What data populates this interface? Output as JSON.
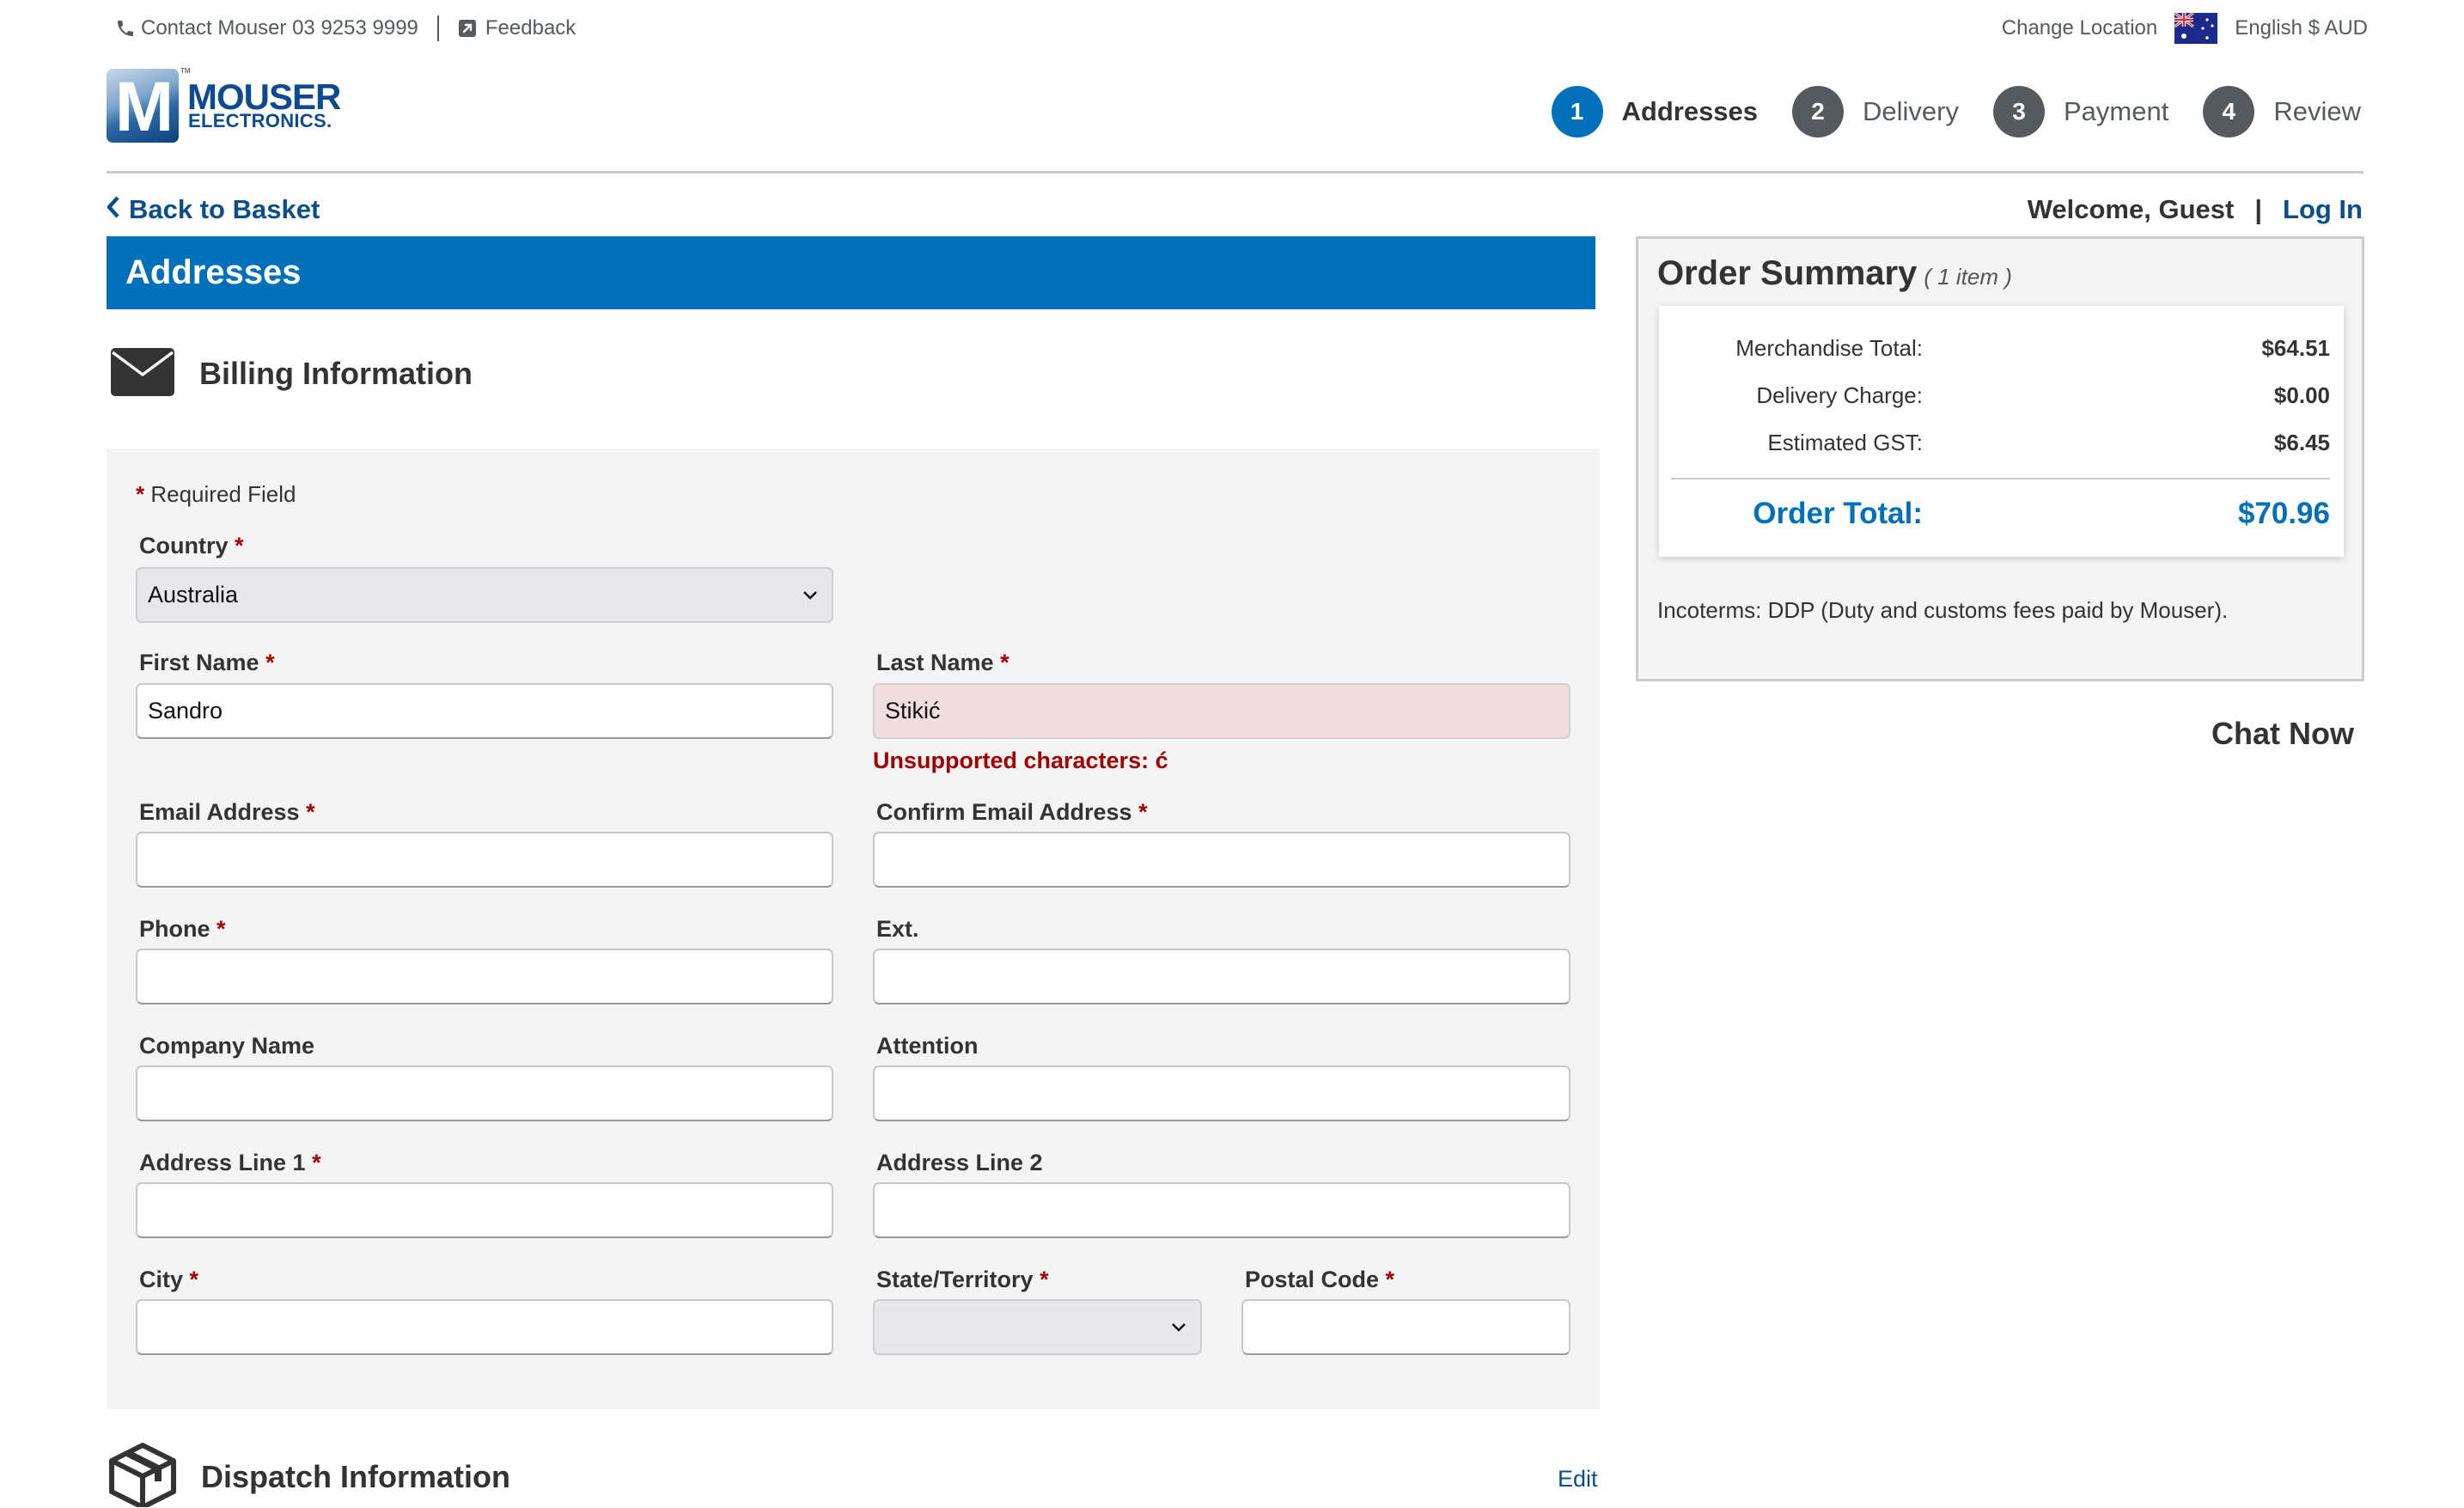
{
  "utility_bar": {
    "contact": "Contact Mouser 03 9253 9999",
    "feedback": "Feedback",
    "change_location": "Change Location",
    "locale": "English $ AUD",
    "flag_icon": "australia-flag-icon"
  },
  "logo": {
    "letter": "M",
    "tm": "TM",
    "word1": "MOUSER",
    "word2": "ELECTRONICS."
  },
  "stepper": [
    {
      "number": "1",
      "label": "Addresses",
      "active": true
    },
    {
      "number": "2",
      "label": "Delivery",
      "active": false
    },
    {
      "number": "3",
      "label": "Payment",
      "active": false
    },
    {
      "number": "4",
      "label": "Review",
      "active": false
    }
  ],
  "nav": {
    "back_to_basket": "Back to Basket",
    "welcome": "Welcome, Guest",
    "separator": "|",
    "log_in": "Log In"
  },
  "page_title": "Addresses",
  "billing": {
    "title": "Billing Information",
    "required_note": "Required Field",
    "required_marker": "*",
    "country": {
      "label": "Country",
      "value": "Australia"
    },
    "first_name": {
      "label": "First Name",
      "value": "Sandro"
    },
    "last_name": {
      "label": "Last Name",
      "value": "Stikić",
      "error": "Unsupported characters: ć"
    },
    "email": {
      "label": "Email Address",
      "value": ""
    },
    "confirm_email": {
      "label": "Confirm Email Address",
      "value": ""
    },
    "phone": {
      "label": "Phone",
      "value": ""
    },
    "ext": {
      "label": "Ext.",
      "value": ""
    },
    "company": {
      "label": "Company Name",
      "value": ""
    },
    "attention": {
      "label": "Attention",
      "value": ""
    },
    "address1": {
      "label": "Address Line 1",
      "value": ""
    },
    "address2": {
      "label": "Address Line 2",
      "value": ""
    },
    "city": {
      "label": "City",
      "value": ""
    },
    "state": {
      "label": "State/Territory",
      "value": ""
    },
    "postal": {
      "label": "Postal Code",
      "value": ""
    }
  },
  "dispatch": {
    "title": "Dispatch Information",
    "edit": "Edit"
  },
  "order_summary": {
    "title": "Order Summary",
    "item_count": "( 1 item )",
    "rows": [
      {
        "label": "Merchandise Total:",
        "value": "$64.51"
      },
      {
        "label": "Delivery Charge:",
        "value": "$0.00"
      },
      {
        "label": "Estimated GST:",
        "value": "$6.45"
      }
    ],
    "total_label": "Order Total:",
    "total_value": "$70.96",
    "incoterms": "Incoterms: DDP (Duty and customs fees paid by Mouser)."
  },
  "chat_now": "Chat Now",
  "colors": {
    "brand_blue": "#0070bb",
    "link_blue": "#0a4f8c",
    "error_red": "#a30000",
    "error_bg": "#f2dede",
    "step_inactive": "#555a5e"
  }
}
